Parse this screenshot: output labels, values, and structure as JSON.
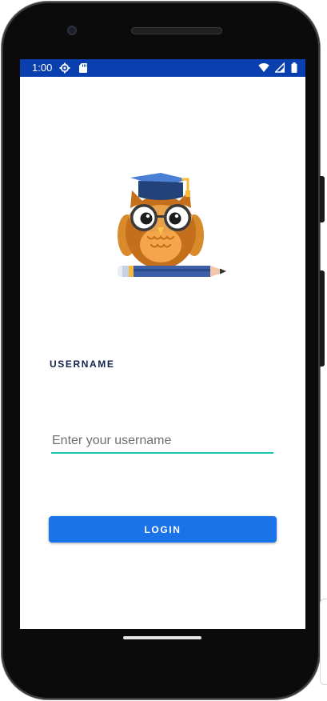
{
  "status_bar": {
    "time": "1:00",
    "left_icons": [
      "settings-icon",
      "sd-card-icon"
    ],
    "right_icons": [
      "wifi-icon",
      "cell-signal-icon",
      "battery-icon"
    ],
    "color": "#0a3fb0"
  },
  "login": {
    "username_label": "USERNAME",
    "username_placeholder": "Enter your username",
    "username_value": "",
    "login_button_label": "LOGIN",
    "accent_color": "#18c6b4",
    "button_color": "#1a73e8"
  },
  "mascot": {
    "icon": "owl-graduate-icon"
  }
}
